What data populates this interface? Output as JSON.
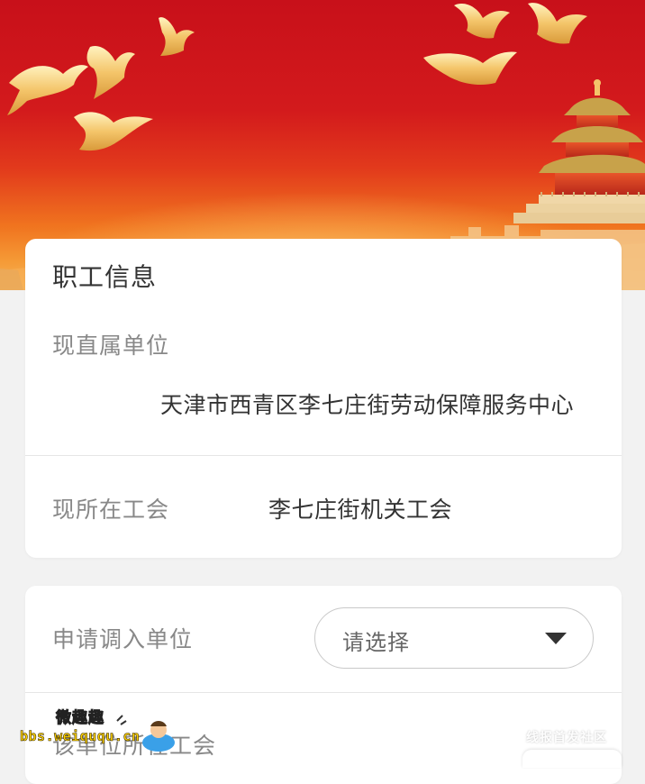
{
  "employee_info": {
    "title": "职工信息",
    "current_unit_label": "现直属单位",
    "current_unit_value": "天津市西青区李七庄街劳动保障服务中心",
    "current_union_label": "现所在工会",
    "current_union_value": "李七庄街机关工会"
  },
  "transfer": {
    "target_unit_label": "申请调入单位",
    "target_unit_placeholder": "请选择",
    "target_union_label": "该单位所在工会"
  },
  "watermarks": {
    "left_title": "微趣趣",
    "left_url": "bbs.weiququ.cn",
    "right_text": "线报首发社区"
  },
  "icons": {
    "dropdown": "caret-down-icon",
    "banner": "doves-temple-banner"
  },
  "colors": {
    "banner_red": "#d31a1c",
    "banner_gold": "#f6b55a",
    "page_background": "#f2f2f2"
  }
}
